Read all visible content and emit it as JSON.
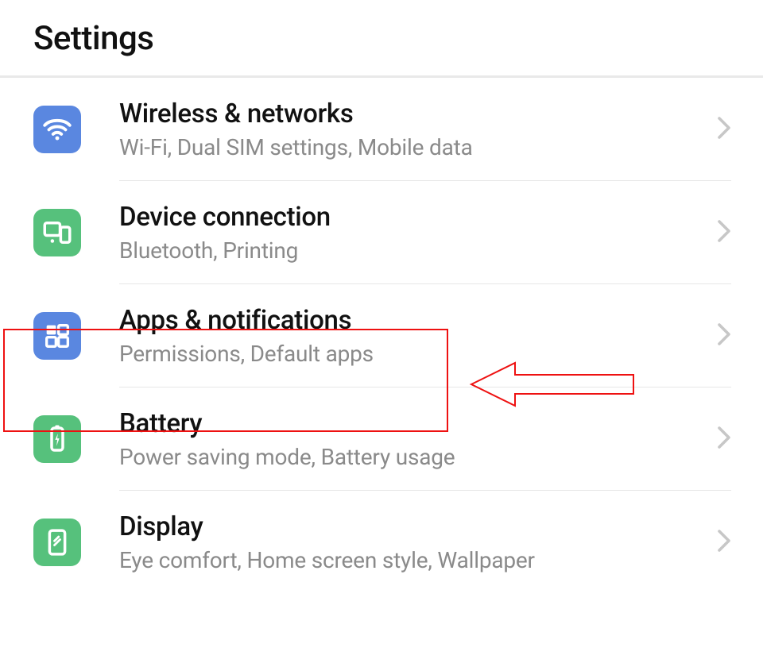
{
  "header": {
    "title": "Settings"
  },
  "items": [
    {
      "id": "wireless",
      "title": "Wireless & networks",
      "subtitle": "Wi-Fi, Dual SIM settings, Mobile data",
      "icon": "wifi-icon",
      "color": "blue"
    },
    {
      "id": "device-connection",
      "title": "Device connection",
      "subtitle": "Bluetooth, Printing",
      "icon": "devices-icon",
      "color": "green"
    },
    {
      "id": "apps-notifications",
      "title": "Apps & notifications",
      "subtitle": "Permissions, Default apps",
      "icon": "apps-icon",
      "color": "blue"
    },
    {
      "id": "battery",
      "title": "Battery",
      "subtitle": "Power saving mode, Battery usage",
      "icon": "battery-icon",
      "color": "green"
    },
    {
      "id": "display",
      "title": "Display",
      "subtitle": "Eye comfort, Home screen style, Wallpaper",
      "icon": "display-icon",
      "color": "green"
    }
  ],
  "annotation": {
    "highlight_item": "apps-notifications",
    "highlight_color": "#ee1111"
  }
}
